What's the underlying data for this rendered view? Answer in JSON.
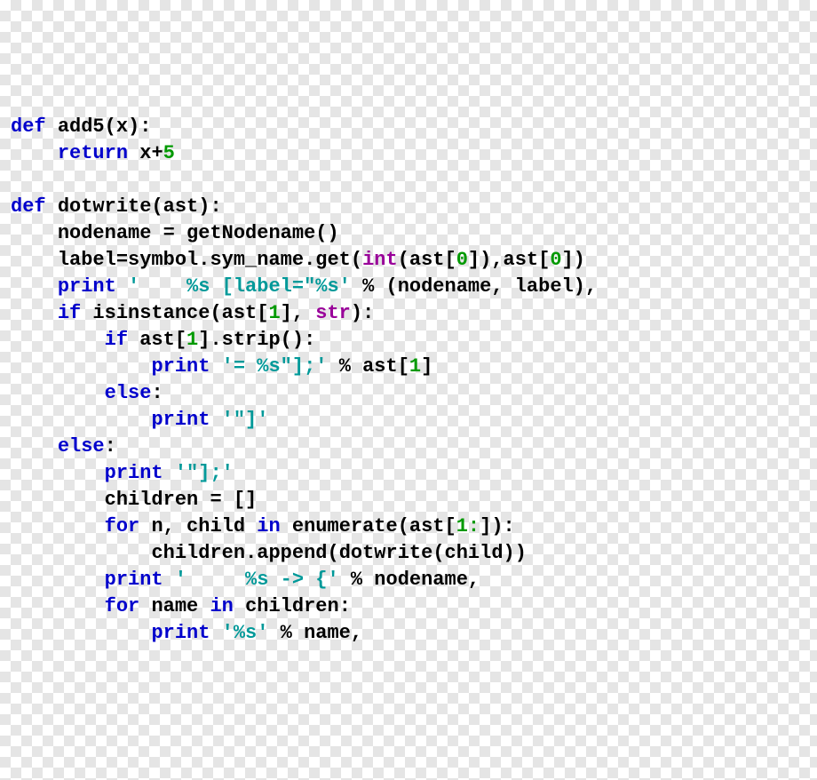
{
  "kw": {
    "def": "def",
    "return": "return",
    "print": "print",
    "if": "if",
    "else": "else",
    "for": "for",
    "in": "in"
  },
  "bi": {
    "int": "int",
    "str": "str"
  },
  "num": {
    "zero": "0",
    "one": "1",
    "five": "5"
  },
  "str": {
    "labelFmt": "'    %s [label=\"%s'",
    "eqFmt": "'= %s\"];'",
    "closeBracket": "'\"]'",
    "closeBracketSemi": "'\"];'",
    "arrowFmt": "'     %s -> {'",
    "pctS": "'%s'"
  },
  "id": {
    "add5": "add5",
    "x": "x",
    "dotwrite": "dotwrite",
    "ast": "ast",
    "nodename": "nodename",
    "getNodename": "getNodename",
    "label": "label",
    "symbol": "symbol",
    "sym_name": "sym_name",
    "get": "get",
    "isinstance": "isinstance",
    "strip": "strip",
    "children": "children",
    "n": "n",
    "child": "child",
    "enumerate": "enumerate",
    "append": "append",
    "name": "name"
  },
  "op": {
    "lp": "(",
    "rp": ")",
    "colon": ":",
    "plus": "+",
    "eq": "=",
    "dot": ".",
    "lb": "[",
    "rb": "]",
    "comma": ",",
    "pct": "%",
    "sp": " ",
    "emptyList": "[]",
    "oneColon": "1:"
  }
}
